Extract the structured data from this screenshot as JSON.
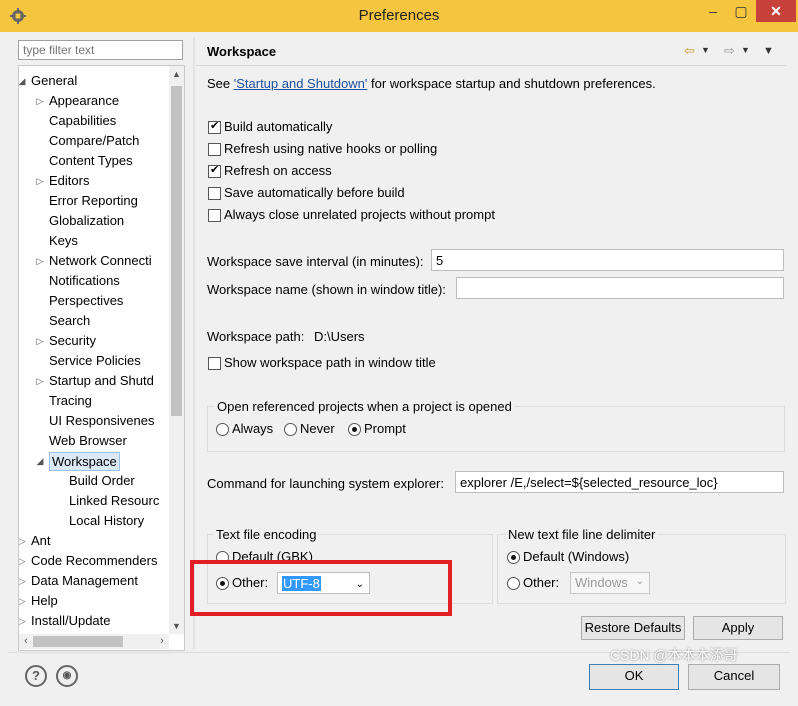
{
  "window": {
    "title": "Preferences",
    "icon": "settings-gear-icon",
    "controls": [
      "–",
      "▢",
      "✕"
    ]
  },
  "filter": {
    "placeholder": "type filter text"
  },
  "tree": [
    {
      "label": "General",
      "level": 0,
      "expanded": true
    },
    {
      "label": "Appearance",
      "level": 1,
      "arrow": true
    },
    {
      "label": "Capabilities",
      "level": 1
    },
    {
      "label": "Compare/Patch",
      "level": 1
    },
    {
      "label": "Content Types",
      "level": 1
    },
    {
      "label": "Editors",
      "level": 1,
      "arrow": true
    },
    {
      "label": "Error Reporting",
      "level": 1
    },
    {
      "label": "Globalization",
      "level": 1
    },
    {
      "label": "Keys",
      "level": 1
    },
    {
      "label": "Network Connecti",
      "level": 1,
      "arrow": true
    },
    {
      "label": "Notifications",
      "level": 1
    },
    {
      "label": "Perspectives",
      "level": 1
    },
    {
      "label": "Search",
      "level": 1
    },
    {
      "label": "Security",
      "level": 1,
      "arrow": true
    },
    {
      "label": "Service Policies",
      "level": 1
    },
    {
      "label": "Startup and Shutd",
      "level": 1,
      "arrow": true
    },
    {
      "label": "Tracing",
      "level": 1
    },
    {
      "label": "UI Responsivenes",
      "level": 1
    },
    {
      "label": "Web Browser",
      "level": 1
    },
    {
      "label": "Workspace",
      "level": 1,
      "expanded": true,
      "selected": true
    },
    {
      "label": "Build Order",
      "level": 2
    },
    {
      "label": "Linked Resourc",
      "level": 2
    },
    {
      "label": "Local History",
      "level": 2
    },
    {
      "label": "Ant",
      "level": 0,
      "arrow": true
    },
    {
      "label": "Code Recommenders",
      "level": 0,
      "arrow": true
    },
    {
      "label": "Data Management",
      "level": 0,
      "arrow": true
    },
    {
      "label": "Help",
      "level": 0,
      "arrow": true
    },
    {
      "label": "Install/Update",
      "level": 0,
      "arrow": true
    }
  ],
  "page": {
    "title": "Workspace",
    "intro_prefix": "See ",
    "intro_link": "'Startup and Shutdown'",
    "intro_suffix": " for workspace startup and shutdown preferences.",
    "checkboxes": [
      {
        "label": "Build automatically",
        "checked": true
      },
      {
        "label": "Refresh using native hooks or polling",
        "checked": false
      },
      {
        "label": "Refresh on access",
        "checked": true
      },
      {
        "label": "Save automatically before build",
        "checked": false
      },
      {
        "label": "Always close unrelated projects without prompt",
        "checked": false
      }
    ],
    "save_interval_label": "Workspace save interval (in minutes):",
    "save_interval_value": "5",
    "name_label": "Workspace name (shown in window title):",
    "name_value": "",
    "path_label": "Workspace path:",
    "path_value": "D:\\Users",
    "show_path_label": "Show workspace path in window title",
    "open_projects": {
      "label": "Open referenced projects when a project is opened",
      "options": [
        "Always",
        "Never",
        "Prompt"
      ],
      "selected": "Prompt"
    },
    "explorer_label": "Command for launching system explorer:",
    "explorer_value": "explorer /E,/select=${selected_resource_loc}",
    "encoding": {
      "label": "Text file encoding",
      "default_label": "Default (GBK)",
      "other_label": "Other:",
      "other_value": "UTF-8",
      "selected": "Other"
    },
    "delimiter": {
      "label": "New text file line delimiter",
      "default_label": "Default (Windows)",
      "other_label": "Other:",
      "other_value": "Windows",
      "selected": "Default"
    },
    "restore_label": "Restore Defaults",
    "apply_label": "Apply"
  },
  "footer": {
    "ok_label": "OK",
    "cancel_label": "Cancel",
    "help_icon": "help-icon",
    "import_export_icon": "import-export-icon"
  },
  "watermark": "CSDN @本本本添哥",
  "highlight_color": "#e21f26"
}
